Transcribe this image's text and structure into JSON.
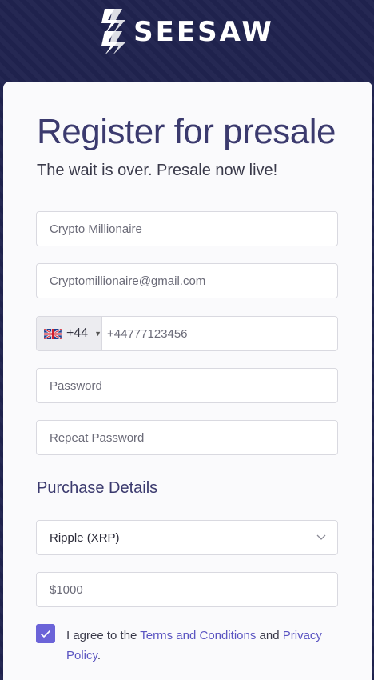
{
  "brand": {
    "name": "SEESAW"
  },
  "form": {
    "title": "Register for presale",
    "subtitle": "The wait is over. Presale now live!",
    "name_value": "Crypto Millionaire",
    "email_value": "Cryptomillionaire@gmail.com",
    "phone": {
      "country_code": "+44",
      "number": "+44777123456",
      "flag_icon": "uk-flag-icon"
    },
    "password_placeholder": "Password",
    "repeat_password_placeholder": "Repeat Password"
  },
  "purchase": {
    "section_title": "Purchase Details",
    "currency_selected": "Ripple (XRP)",
    "amount_value": "$1000"
  },
  "agreement": {
    "checked": true,
    "prefix": "I agree to the ",
    "terms_link": "Terms and Conditions",
    "middle": " and ",
    "privacy_link": "Privacy Policy",
    "suffix": "."
  },
  "colors": {
    "header_bg": "#20234f",
    "accent": "#6b63d8",
    "title": "#3b3a6e"
  }
}
